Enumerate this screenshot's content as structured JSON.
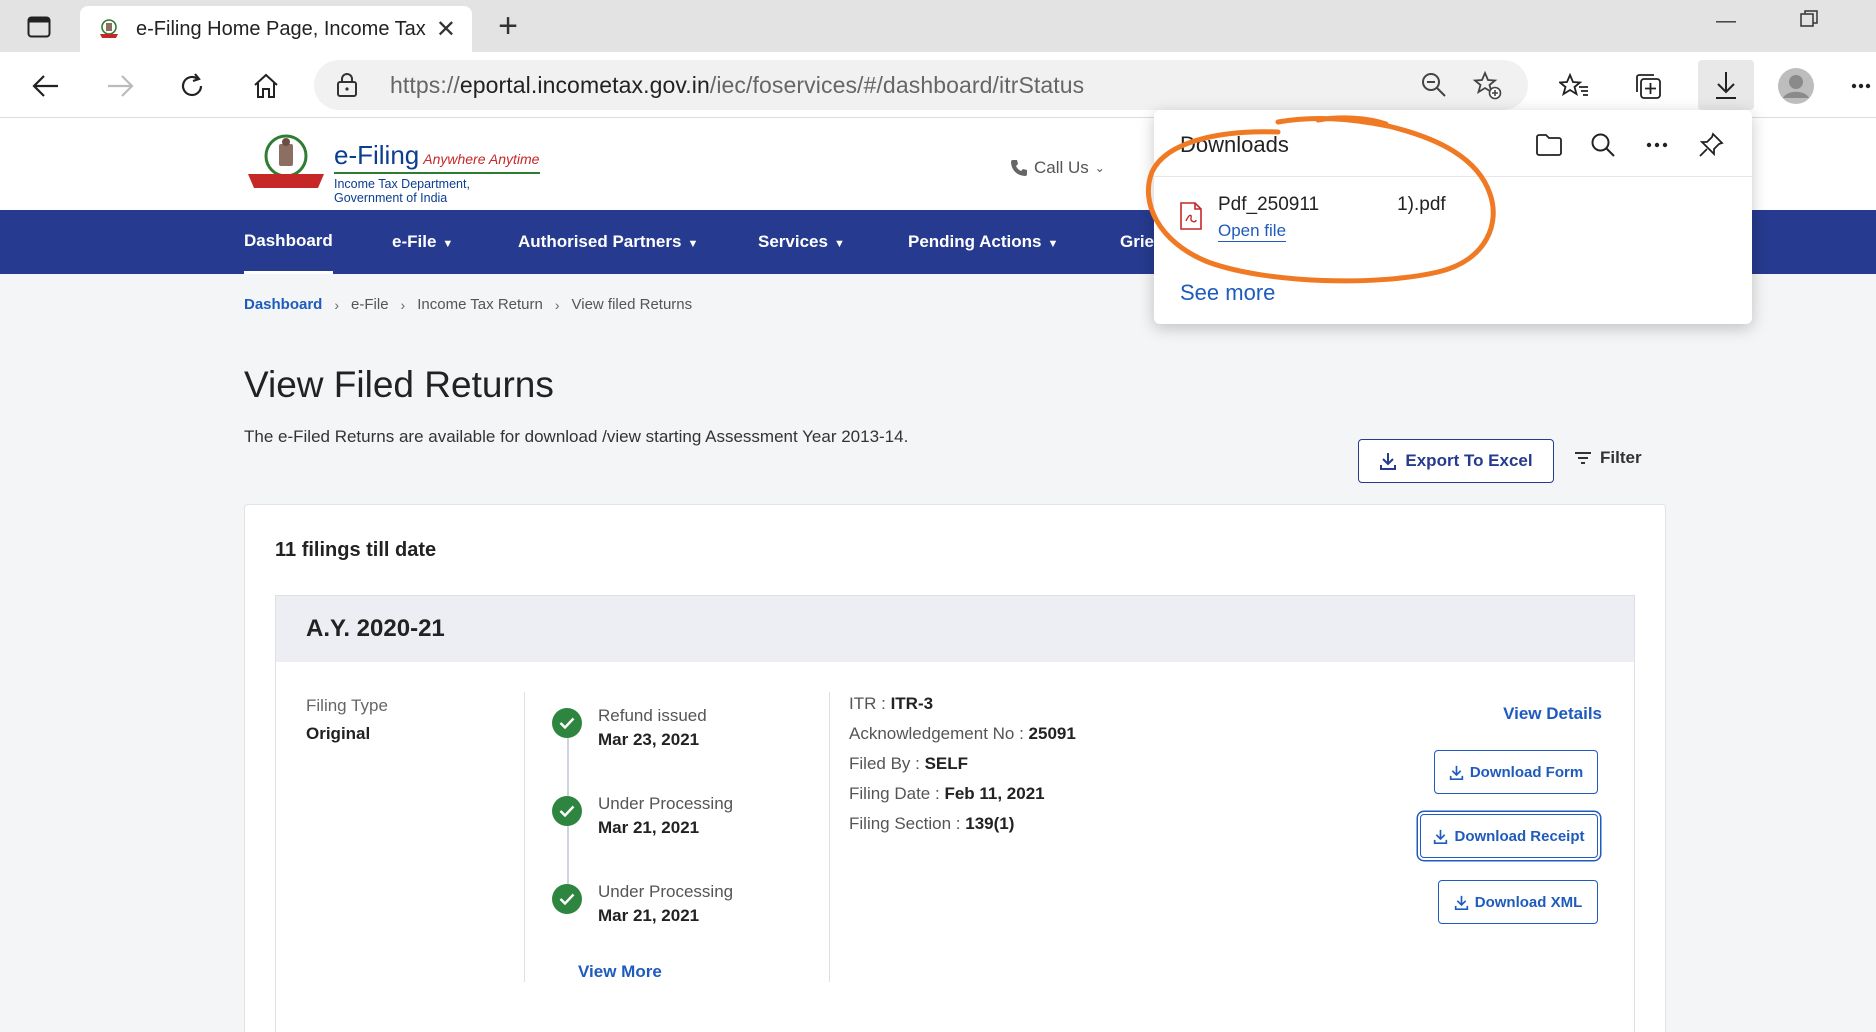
{
  "browser": {
    "tab_title": "e-Filing Home Page, Income Tax",
    "url_scheme": "https://",
    "url_host": "eportal.incometax.gov.in",
    "url_path": "/iec/foservices/#/dashboard/itrStatus"
  },
  "header": {
    "logo_title": "e-Filing",
    "logo_tagline": "Anywhere Anytime",
    "logo_subtitle": "Income Tax Department, Government of India",
    "call_us": "Call Us"
  },
  "nav": {
    "items": [
      {
        "label": "Dashboard"
      },
      {
        "label": "e-File"
      },
      {
        "label": "Authorised Partners"
      },
      {
        "label": "Services"
      },
      {
        "label": "Pending Actions"
      },
      {
        "label": "Grie"
      }
    ]
  },
  "breadcrumb": [
    "Dashboard",
    "e-File",
    "Income Tax Return",
    "View filed Returns"
  ],
  "page": {
    "title": "View Filed Returns",
    "description": "The e-Filed Returns are available for download /view starting Assessment Year 2013-14.",
    "export_label": "Export To Excel",
    "filter_label": "Filter",
    "filings_count": "11 filings till date"
  },
  "return": {
    "ay": "A.Y. 2020-21",
    "filing_type_label": "Filing Type",
    "filing_type_value": "Original",
    "timeline": [
      {
        "status": "Refund issued",
        "date": "Mar 23, 2021"
      },
      {
        "status": "Under Processing",
        "date": "Mar 21, 2021"
      },
      {
        "status": "Under Processing",
        "date": "Mar 21, 2021"
      }
    ],
    "view_more": "View More",
    "details": {
      "itr_label": "ITR : ",
      "itr_value": "ITR-3",
      "ack_label": "Acknowledgement No : ",
      "ack_value": "25091",
      "filed_by_label": "Filed By : ",
      "filed_by_value": "SELF",
      "filing_date_label": "Filing Date : ",
      "filing_date_value": "Feb 11, 2021",
      "filing_section_label": "Filing Section : ",
      "filing_section_value": "139(1)"
    },
    "view_details": "View Details",
    "download_form": "Download Form",
    "download_receipt": "Download Receipt",
    "download_xml": "Download XML"
  },
  "downloads_panel": {
    "title": "Downloads",
    "file_name": "Pdf_250911",
    "file_name_tail": "1).pdf",
    "open_file": "Open file",
    "see_more": "See more"
  },
  "colors": {
    "nav_bg": "#263a8f",
    "link": "#1f5bbd",
    "success": "#2e8540",
    "annotation": "#f07a24"
  }
}
